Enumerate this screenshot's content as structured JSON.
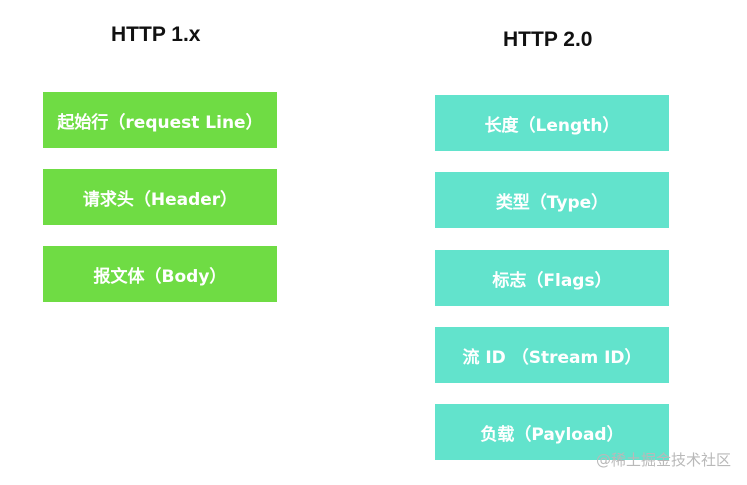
{
  "http1": {
    "title": "HTTP 1.x",
    "color": "#6fdc44",
    "items": [
      {
        "label": "起始行（request Line）"
      },
      {
        "label": "请求头（Header）"
      },
      {
        "label": "报文体（Body）"
      }
    ]
  },
  "http2": {
    "title": "HTTP 2.0",
    "color": "#62e3cc",
    "items": [
      {
        "label": "长度（Length）"
      },
      {
        "label": "类型（Type）"
      },
      {
        "label": "标志（Flags）"
      },
      {
        "label": "流 ID （Stream ID）"
      },
      {
        "label": "负载（Payload）"
      }
    ]
  },
  "watermark": "@稀土掘金技术社区"
}
